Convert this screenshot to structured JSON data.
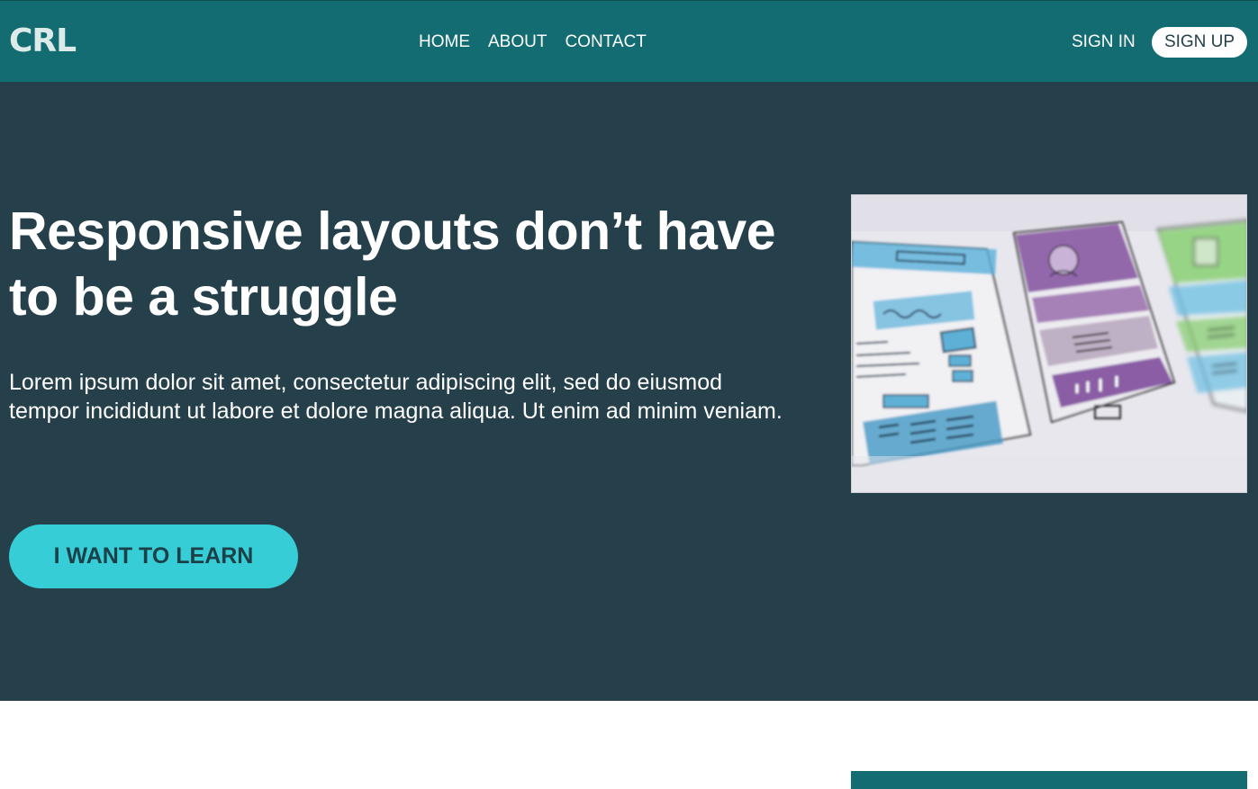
{
  "logo": {
    "text": "CRL"
  },
  "nav": {
    "links": [
      {
        "label": "HOME"
      },
      {
        "label": "ABOUT"
      },
      {
        "label": "CONTACT"
      }
    ],
    "sign_in": "SIGN IN",
    "sign_up": "SIGN UP"
  },
  "hero": {
    "title_line1": "Responsive layouts don’t have",
    "title_line2": "to be a struggle",
    "text": "Lorem ipsum dolor sit amet, consectetur adipiscing elit, sed do eiusmod tempor incididunt ut labore et dolore magna aliqua. Ut enim ad minim veniam.",
    "cta_label": "I WANT TO LEARN",
    "image_icon": "wireframe-sketch-image"
  },
  "colors": {
    "navbar": "#136c72",
    "hero_bg": "#25404b",
    "cta_bg": "#36cdd7",
    "cta_text": "#1c4048"
  }
}
